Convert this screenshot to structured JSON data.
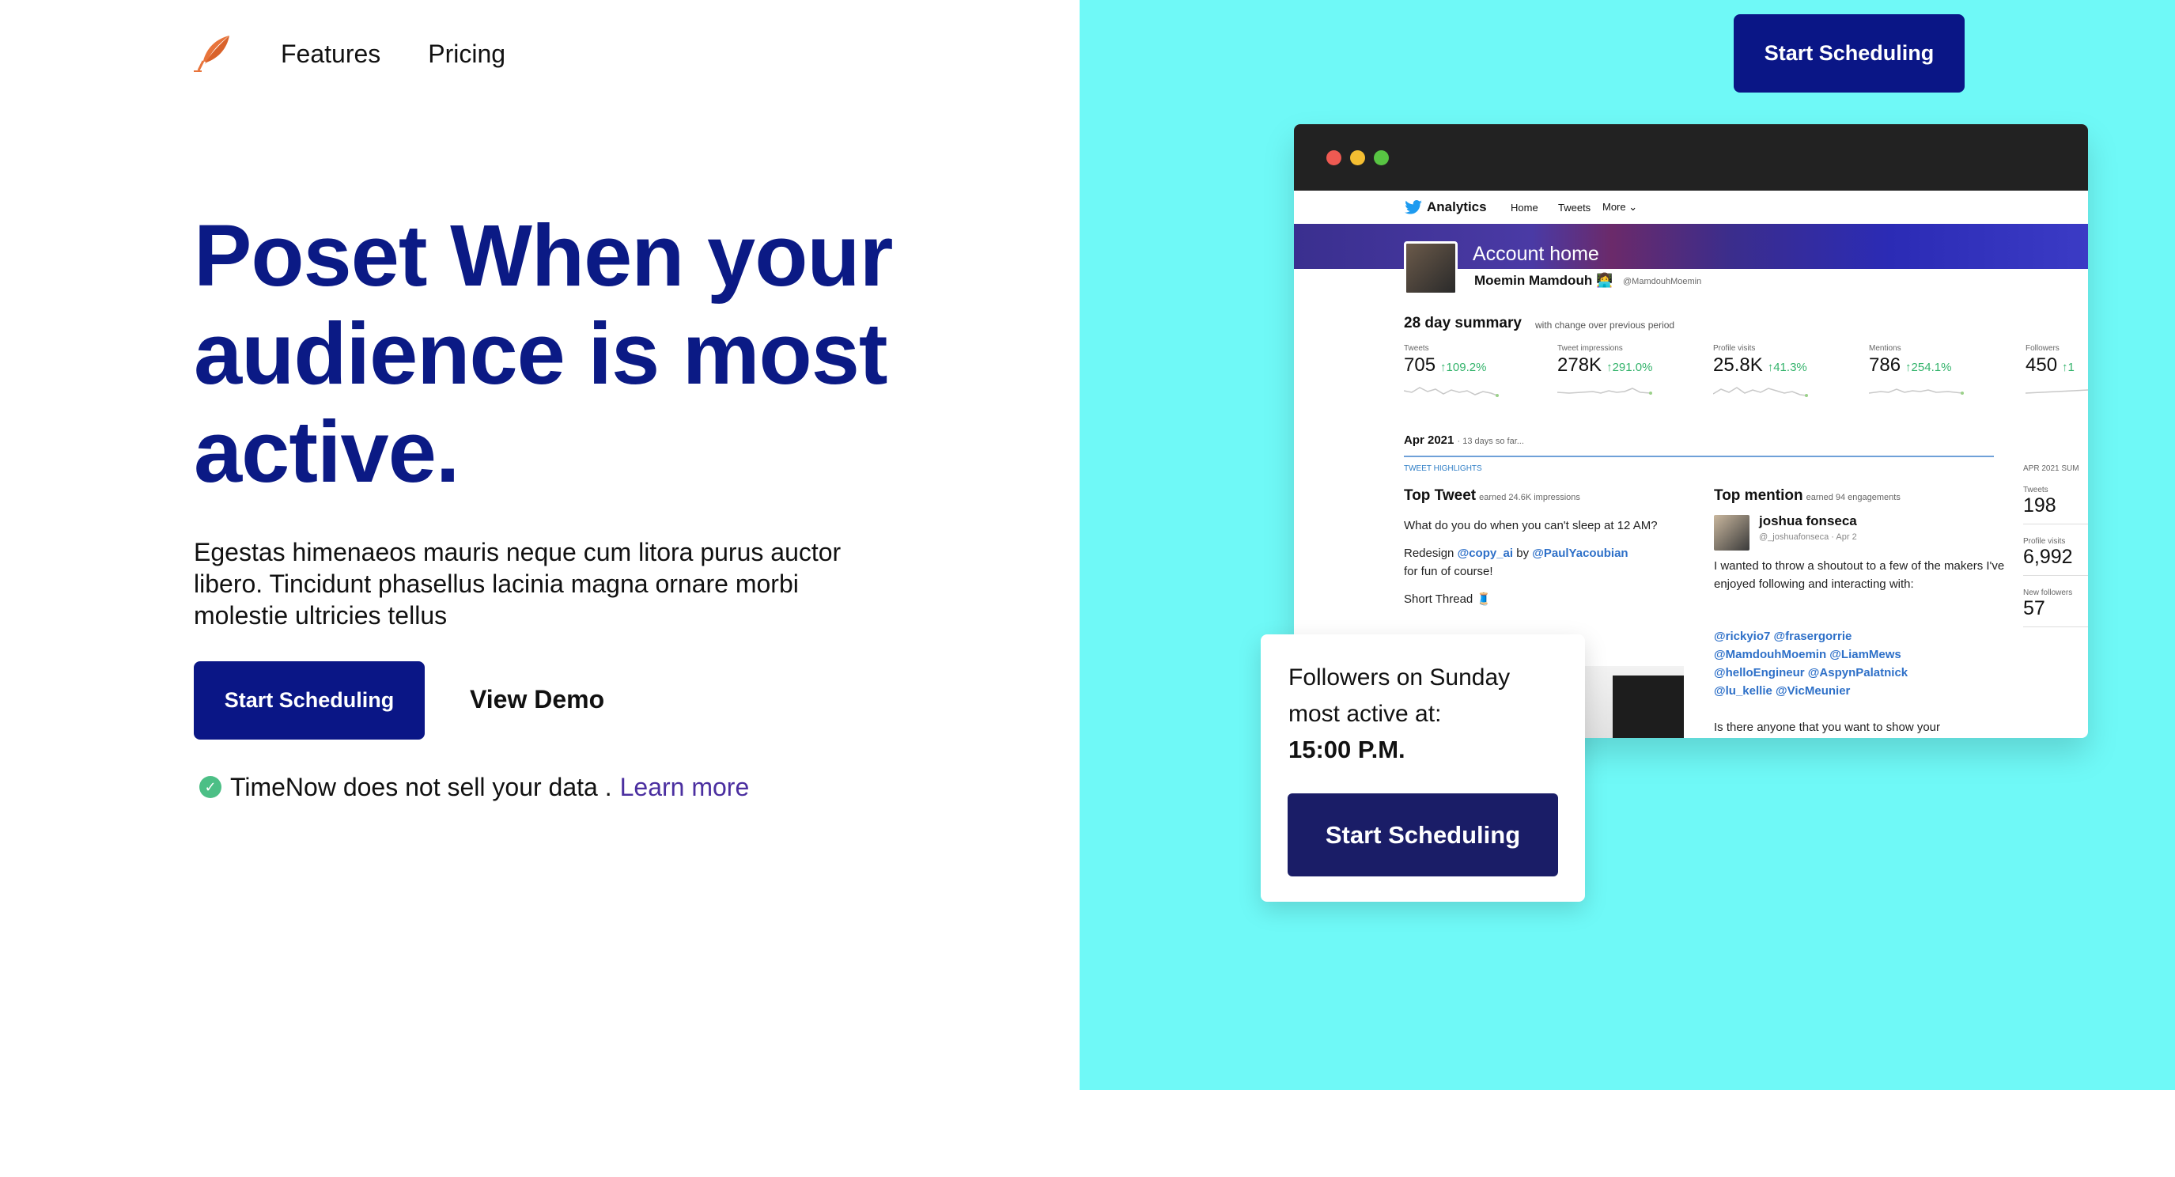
{
  "nav": {
    "logo_icon": "feather-logo-icon",
    "logo_color": "#e8743b",
    "features": "Features",
    "pricing": "Pricing"
  },
  "hero": {
    "title": "Poset When your audience is most active.",
    "subtitle": "Egestas himenaeos mauris neque cum litora purus auctor libero. Tincidunt phasellus lacinia magna ornare morbi molestie ultricies tellus",
    "primary_cta": "Start Scheduling",
    "secondary_cta": "View Demo",
    "notice_text": "TimeNow does not sell your data .",
    "notice_link": "Learn more"
  },
  "top_cta": "Start Scheduling",
  "colors": {
    "navy": "#0a1686",
    "cyan_panel": "#6ff9f7",
    "check_green": "#4cbf86",
    "link_purple": "#4b2fa0"
  },
  "analytics": {
    "brand": "Analytics",
    "tabs": [
      "Home",
      "Tweets",
      "More"
    ],
    "banner_title": "Account home",
    "account_name": "Moemin Mamdouh",
    "account_handle": "@MamdouhMoemin",
    "summary_title": "28 day summary",
    "summary_sub": "with change over previous period",
    "stats": [
      {
        "label": "Tweets",
        "value": "705",
        "delta": "↑109.2%"
      },
      {
        "label": "Tweet impressions",
        "value": "278K",
        "delta": "↑291.0%"
      },
      {
        "label": "Profile visits",
        "value": "25.8K",
        "delta": "↑41.3%"
      },
      {
        "label": "Mentions",
        "value": "786",
        "delta": "↑254.1%"
      },
      {
        "label": "Followers",
        "value": "450",
        "delta": "↑1"
      }
    ],
    "period": "Apr 2021",
    "period_sub": "· 13 days so far...",
    "highlights_label": "TWEET HIGHLIGHTS",
    "top_tweet_title": "Top Tweet",
    "top_tweet_meta": "earned 24.6K impressions",
    "top_tweet_line1": "What do you do when you can't sleep at 12 AM?",
    "top_tweet_line2_prefix": "Redesign",
    "top_tweet_link1": "@copy_ai",
    "top_tweet_by": "by",
    "top_tweet_link2": "@PaulYacoubian",
    "top_tweet_line3": "for fun of course!",
    "top_tweet_line4": "Short Thread 🧵",
    "top_mention_title": "Top mention",
    "top_mention_meta": "earned 94 engagements",
    "mention_name": "joshua fonseca",
    "mention_handle": "@_joshuafonseca · Apr 2",
    "mention_body": "I wanted to throw a shoutout to a few of the makers I've enjoyed following and interacting with:",
    "mention_links": [
      "@rickyio7 @frasergorrie",
      "@MamdouhMoemin @LiamMews",
      "@helloEngineur @AspynPalatnick",
      "@lu_kellie @VicMeunier"
    ],
    "mention_end": "Is there anyone that you want to show your",
    "side_title": "APR 2021 SUM",
    "side_stats": [
      {
        "label": "Tweets",
        "value": "198"
      },
      {
        "label": "Profile visits",
        "value": "6,992"
      },
      {
        "label": "New followers",
        "value": "57"
      }
    ]
  },
  "popup": {
    "text": "Followers on Sunday most active at:",
    "time": "15:00 P.M.",
    "cta": "Start Scheduling"
  }
}
